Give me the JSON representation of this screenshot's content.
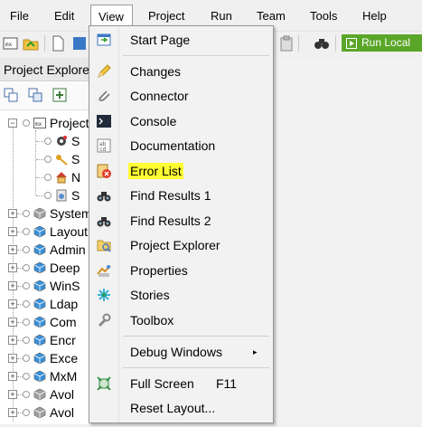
{
  "menubar": {
    "items": [
      "File",
      "Edit",
      "View",
      "Project",
      "Run",
      "Team",
      "Tools",
      "Help"
    ],
    "active_index": 2
  },
  "toolbar": {
    "run_label": "Run Local"
  },
  "pane": {
    "title": "Project Explorer",
    "tree": [
      {
        "label": "Project",
        "expander": "minus"
      },
      {
        "label": "S"
      },
      {
        "label": "S"
      },
      {
        "label": "N"
      },
      {
        "label": "S"
      },
      {
        "label": "System",
        "expander": "plus"
      },
      {
        "label": "Layout",
        "expander": "plus"
      },
      {
        "label": "Admin",
        "expander": "plus"
      },
      {
        "label": "Deep",
        "expander": "plus"
      },
      {
        "label": "WinS",
        "expander": "plus"
      },
      {
        "label": "Ldap",
        "expander": "plus"
      },
      {
        "label": "Com",
        "expander": "plus"
      },
      {
        "label": "Encr",
        "expander": "plus"
      },
      {
        "label": "Exce",
        "expander": "plus"
      },
      {
        "label": "MxM",
        "expander": "plus"
      },
      {
        "label": "Avol",
        "expander": "plus"
      },
      {
        "label": "Avol",
        "expander": "plus"
      }
    ]
  },
  "view_menu": {
    "items": [
      {
        "label": "Start Page",
        "icon": "start-page-icon"
      },
      {
        "label": "Changes",
        "icon": "pencil-icon"
      },
      {
        "label": "Connector",
        "icon": "paperclip-icon"
      },
      {
        "label": "Console",
        "icon": "console-icon"
      },
      {
        "label": "Documentation",
        "icon": "documentation-icon"
      },
      {
        "label": "Error List",
        "icon": "error-list-icon",
        "highlighted": true
      },
      {
        "label": "Find Results 1",
        "icon": "binoculars-icon"
      },
      {
        "label": "Find Results 2",
        "icon": "binoculars-icon"
      },
      {
        "label": "Project Explorer",
        "icon": "project-explorer-icon"
      },
      {
        "label": "Properties",
        "icon": "properties-icon"
      },
      {
        "label": "Stories",
        "icon": "stories-icon"
      },
      {
        "label": "Toolbox",
        "icon": "wrench-icon"
      },
      {
        "label": "Debug Windows",
        "submenu_arrow": "▸"
      },
      {
        "label": "Full Screen",
        "shortcut": "F11",
        "icon": "full-screen-icon"
      },
      {
        "label": "Reset Layout..."
      }
    ]
  },
  "colors": {
    "highlight": "#ffff33",
    "run_button": "#5aa628",
    "menu_bg": "#f2f2f2"
  }
}
